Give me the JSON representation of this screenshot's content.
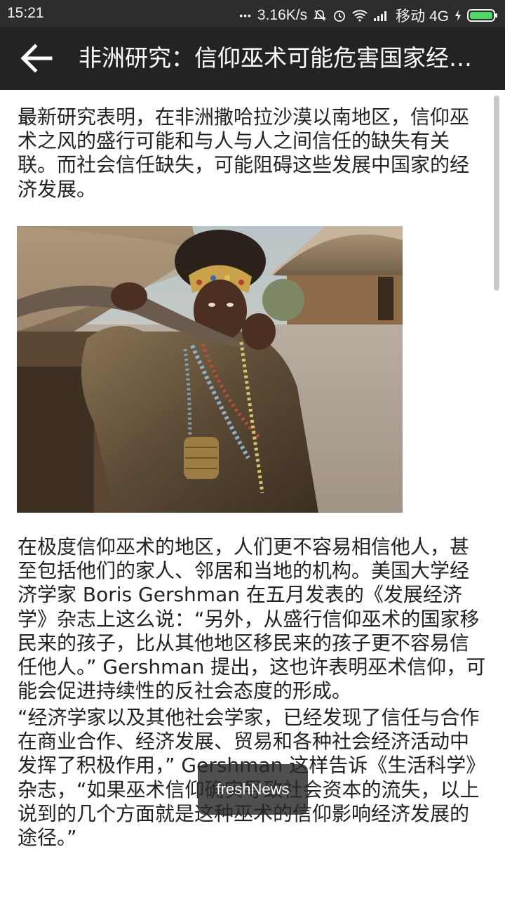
{
  "status_bar": {
    "time": "15:21",
    "dots": "•••",
    "network_speed": "3.16K/s",
    "carrier": "移动 4G",
    "icons": [
      "mute-icon",
      "alarm-icon",
      "wifi-icon",
      "signal-icon",
      "charging-icon",
      "battery-icon"
    ]
  },
  "app_bar": {
    "back_icon": "arrow-left-icon",
    "title": "非洲研究：信仰巫术可能危害国家经济发展"
  },
  "article": {
    "paragraph_1": "最新研究表明，在非洲撒哈拉沙漠以南地区，信仰巫术之风的盛行可能和与人与人之间信任的缺失有关联。而社会信任缺失，可能阻碍这些发展中国家的经济发展。",
    "paragraph_2": "在极度信仰巫术的地区，人们更不容易相信他人，甚至包括他们的家人、邻居和当地的机构。美国大学经济学家 Boris Gershman 在五月发表的《发展经济学》杂志上这么说：“另外，从盛行信仰巫术的国家移民来的孩子，比从其他地区移民来的孩子更不容易信任他人。” Gershman 提出，这也许表明巫术信仰，可能会促进持续性的反社会态度的形成。",
    "paragraph_3": "“经济学家以及其他社会学家，已经发现了信任与合作在商业合作、经济发展、贸易和各种社会经济活动中发挥了积极作用，” Gershman 这样告诉《生活科学》杂志，“如果巫术信仰确实导致社会资本的流失，以上说到的几个方面就是这种巫术的信仰影响经济发展的途径。”"
  },
  "toast": {
    "text": "freshNews"
  },
  "colors": {
    "status_bar_bg": "#2d2d2b",
    "app_bar_bg": "#232321",
    "text": "#222222",
    "battery_green": "#4cd964"
  }
}
